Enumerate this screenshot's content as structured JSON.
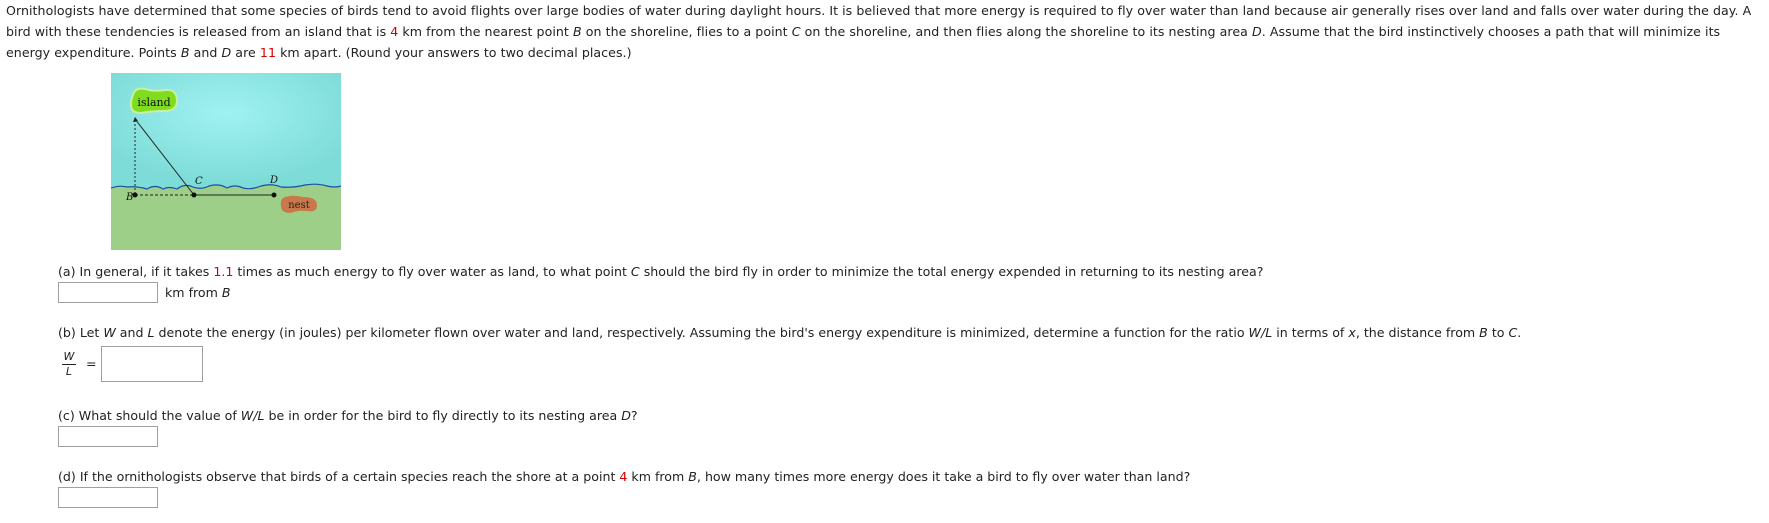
{
  "intro": {
    "s1": "Ornithologists have determined that some species of birds tend to avoid flights over large bodies of water during daylight hours. It is believed that more energy is required to fly over water than land because air generally rises over land and falls over water during the day. A bird with these tendencies is released from an island that is ",
    "island_distance": "4",
    "s2": " km from the nearest point ",
    "B": "B",
    "s3": " on the shoreline, flies to a point ",
    "C": "C",
    "s4": " on the shoreline, and then flies along the shoreline to its nesting area ",
    "D": "D",
    "s5": ". Assume that the bird instinctively chooses a path that will minimize its energy expenditure. Points ",
    "s6": " and ",
    "s7": " are ",
    "bd_distance": "11",
    "s8": " km apart. (Round your answers to two decimal places.)"
  },
  "figure": {
    "island_label": "island",
    "nest_label": "nest",
    "point_b": "B",
    "point_c": "C",
    "point_d": "D",
    "colors": {
      "water_center": "#a0f0f0",
      "water_edge": "#7edcd8",
      "land": "#9ecf88",
      "island": "#7fdc1e",
      "nest": "#c8784a",
      "shoreline": "#1a4fa8"
    }
  },
  "questions": {
    "a": {
      "p1": "(a) In general, if it takes ",
      "ratio": "1.1",
      "p2": " times as much energy to fly over water as land, to what point ",
      "C": "C",
      "p3": " should the bird fly in order to minimize the total energy expended in returning to its nesting area?",
      "unit_p1": "km from ",
      "unit_B": "B",
      "answer": ""
    },
    "b": {
      "p1": "(b) Let ",
      "W": "W",
      "p2": " and ",
      "L": "L",
      "p3": " denote the energy (in joules) per kilometer flown over water and land, respectively. Assuming the bird's energy expenditure is minimized, determine a function for the ratio ",
      "WL": "W/L",
      "p4": " in terms of ",
      "x": "x",
      "p5": ", the distance from ",
      "B": "B",
      "p6": " to ",
      "C": "C",
      "p7": ".",
      "frac_num": "W",
      "frac_den": "L",
      "equals": "=",
      "answer": ""
    },
    "c": {
      "p1": "(c) What should the value of ",
      "WL": "W/L",
      "p2": " be in order for the bird to fly directly to its nesting area ",
      "D": "D",
      "p3": "?",
      "answer": ""
    },
    "d": {
      "p1": "(d) If the ornithologists observe that birds of a certain species reach the shore at a point ",
      "distance": "4",
      "p2": " km from ",
      "B": "B",
      "p3": ", how many times more energy does it take a bird to fly over water than land?",
      "answer": ""
    }
  }
}
